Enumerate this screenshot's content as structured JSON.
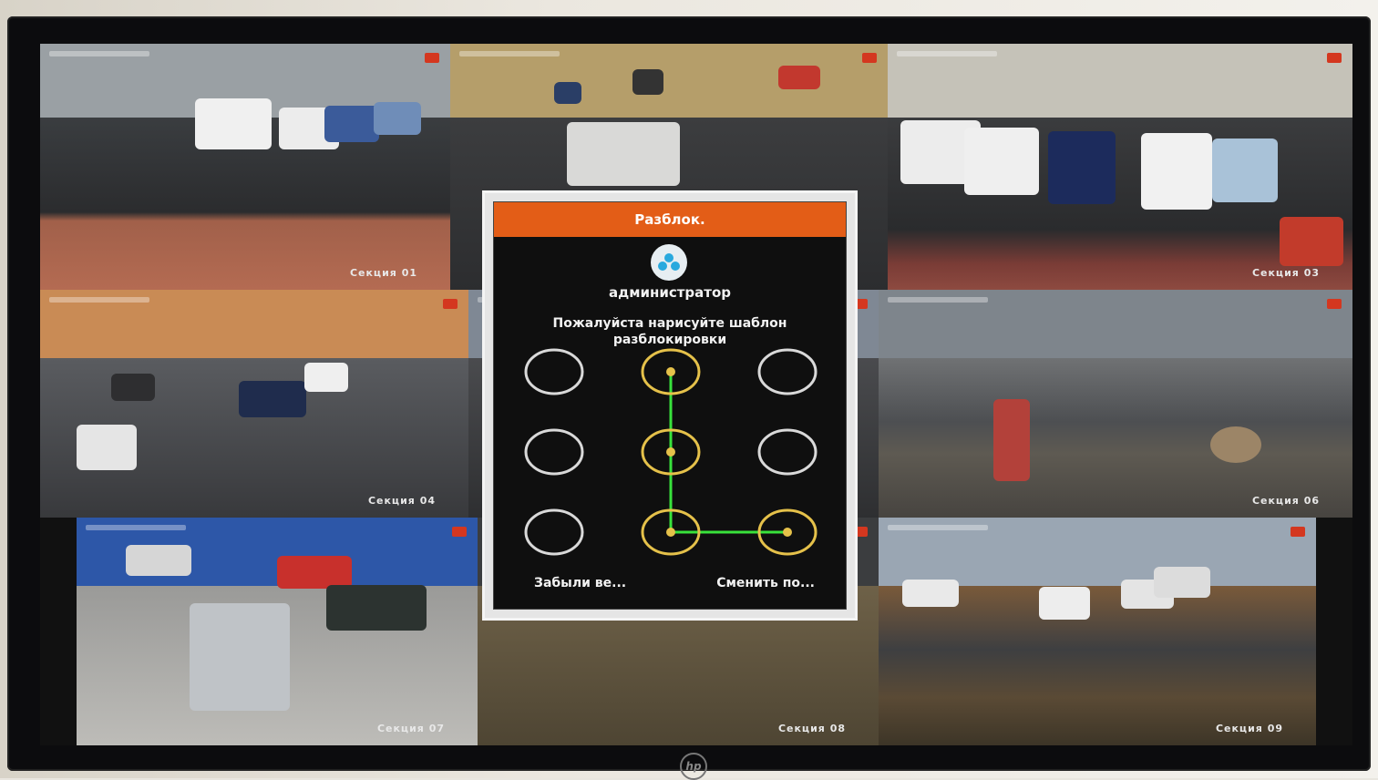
{
  "cameras": [
    {
      "label": "Секция 01"
    },
    {
      "label": ""
    },
    {
      "label": "Секция 03"
    },
    {
      "label": "Секция 04"
    },
    {
      "label": ""
    },
    {
      "label": "Секция 06"
    },
    {
      "label": "Секция 07"
    },
    {
      "label": "Секция 08"
    },
    {
      "label": "Секция 09"
    }
  ],
  "colors": {
    "accent": "#e35d17",
    "pattern_node_active": "#e5c14a",
    "pattern_node_idle": "#d9d9d9",
    "pattern_line": "#38e23b",
    "record_indicator": "#d4371f"
  },
  "dialog": {
    "title": "Разблок.",
    "avatar_icon": "user-group-icon",
    "username": "администратор",
    "prompt": "Пожалуйста нарисуйте шаблон разблокировки",
    "forgot_label": "Забыли ве...",
    "change_label": "Сменить по...",
    "pattern": {
      "grid": 3,
      "path": [
        1,
        4,
        7,
        8
      ]
    }
  },
  "monitor": {
    "brand_icon": "hp-logo-icon"
  }
}
